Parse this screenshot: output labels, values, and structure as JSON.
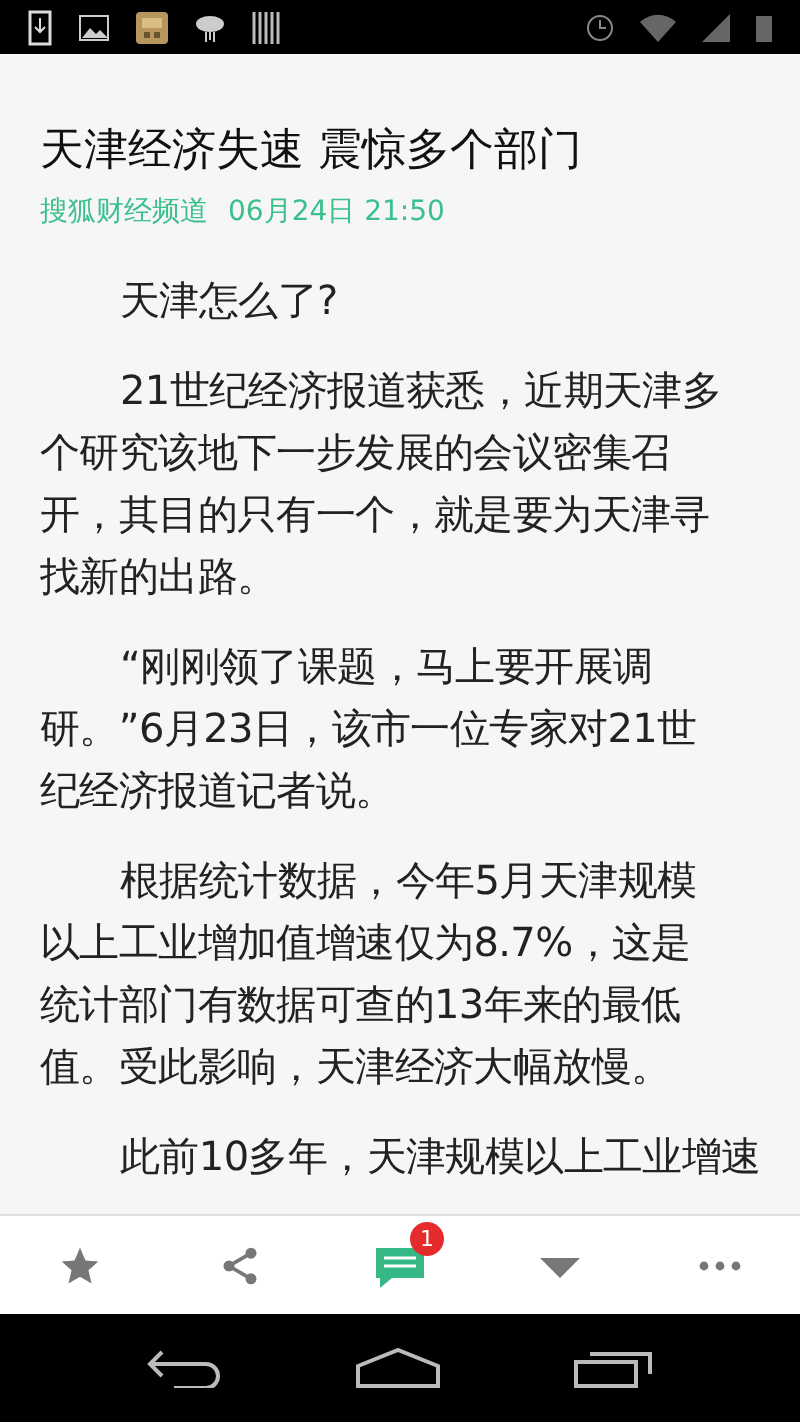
{
  "article": {
    "title": "天津经济失速 震惊多个部门",
    "source": "搜狐财经频道",
    "time": "06月24日 21:50",
    "paragraphs": [
      "天津怎么了?",
      "21世纪经济报道获悉，近期天津多个研究该地下一步发展的会议密集召开，其目的只有一个，就是要为天津寻找新的出路。",
      "“刚刚领了课题，马上要开展调研。”6月23日，该市一位专家对21世纪经济报道记者说。",
      "根据统计数据，今年5月天津规模以上工业增加值增速仅为8.7%，这是统计部门有数据可查的13年来的最低值。受此影响，天津经济大幅放慢。",
      "此前10多年，天津规模以上工业增速"
    ]
  },
  "toolbar": {
    "comment_badge": "1"
  }
}
